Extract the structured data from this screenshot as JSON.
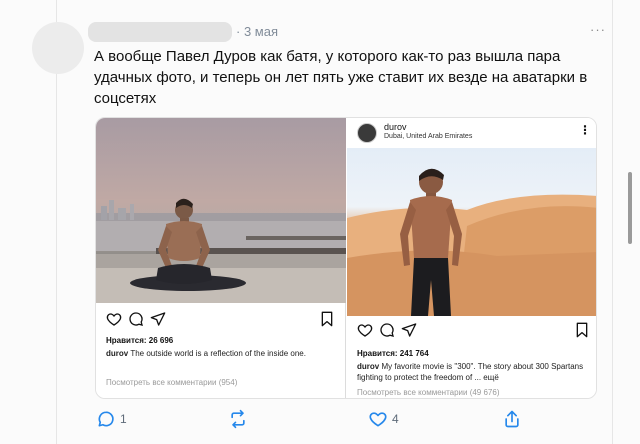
{
  "post": {
    "time": "· 3 мая",
    "text": "А вообще Павел Дуров как батя, у которого как-то раз вышла пара удачных фото, и теперь он лет пять уже ставит их везде на аватарки в соцсетях",
    "more_label": "···"
  },
  "collage": {
    "left": {
      "likes": "Нравится: 26 696",
      "caption_user": "durov",
      "caption_text": " The outside world is a reflection of the inside one.",
      "comments": "Посмотреть все комментарии (954)"
    },
    "right": {
      "header_user": "durov",
      "header_location": "Dubai, United Arab Emirates",
      "header_more": "⋮",
      "likes": "Нравится: 241 764",
      "caption_user": "durov",
      "caption_text": " My favorite movie is \"300\". The story about 300 Spartans fighting to protect the freedom of ... ещё",
      "comments": "Посмотреть все комментарии (49 676)"
    }
  },
  "footer": {
    "comments_count": "1",
    "likes_count": "4"
  },
  "icons": {
    "reply": "speech-bubble-icon",
    "repost": "repost-arrows-icon",
    "like": "heart-icon",
    "share": "share-icon",
    "ig_like": "heart-icon",
    "ig_comment": "comment-bubble-icon",
    "ig_send": "send-paper-plane-icon",
    "ig_save": "bookmark-icon"
  },
  "colors": {
    "accent": "#2688eb",
    "muted_text": "#818c99"
  }
}
